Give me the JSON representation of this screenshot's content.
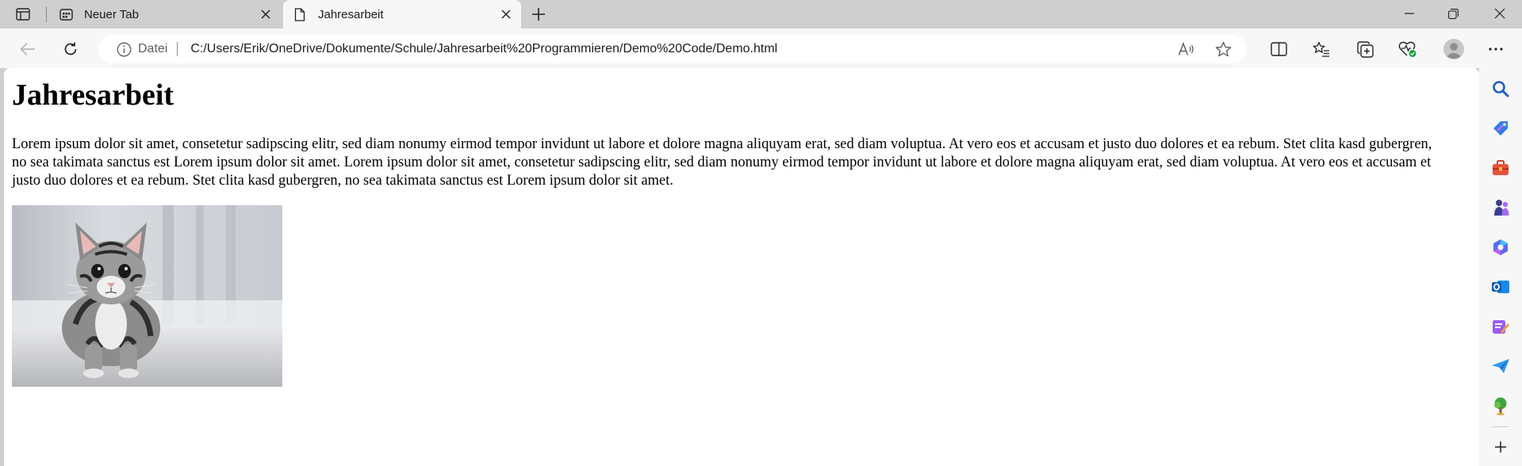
{
  "tabs": [
    {
      "title": "Neuer Tab",
      "icon": "newtab-icon",
      "active": false
    },
    {
      "title": "Jahresarbeit",
      "icon": "page-icon",
      "active": true
    }
  ],
  "address_bar": {
    "scheme_label": "Datei",
    "url": "C:/Users/Erik/OneDrive/Dokumente/Schule/Jahresarbeit%20Programmieren/Demo%20Code/Demo.html"
  },
  "toolbar_icons": [
    "back-icon",
    "refresh-icon",
    "read-aloud-icon",
    "favorite-star-icon",
    "split-screen-icon",
    "favorites-icon",
    "collections-icon",
    "browser-essentials-icon",
    "profile-icon",
    "more-icon"
  ],
  "sidebar_icons": [
    "search-icon",
    "shopping-icon",
    "tools-icon",
    "games-icon",
    "copilot-icon",
    "outlook-icon",
    "designer-icon",
    "send-icon",
    "tree-icon",
    "add-icon"
  ],
  "page": {
    "heading": "Jahresarbeit",
    "paragraph": "Lorem ipsum dolor sit amet, consetetur sadipscing elitr, sed diam nonumy eirmod tempor invidunt ut labore et dolore magna aliquyam erat, sed diam voluptua. At vero eos et accusam et justo duo dolores et ea rebum. Stet clita kasd gubergren, no sea takimata sanctus est Lorem ipsum dolor sit amet. Lorem ipsum dolor sit amet, consetetur sadipscing elitr, sed diam nonumy eirmod tempor invidunt ut labore et dolore magna aliquyam erat, sed diam voluptua. At vero eos et accusam et justo duo dolores et ea rebum. Stet clita kasd gubergren, no sea takimata sanctus est Lorem ipsum dolor sit amet.",
    "image_subject": "kitten-photo"
  },
  "colors": {
    "chrome": "#cfcfcf",
    "toolbar": "#f7f7f7",
    "content": "#ffffff",
    "text": "#000000"
  }
}
